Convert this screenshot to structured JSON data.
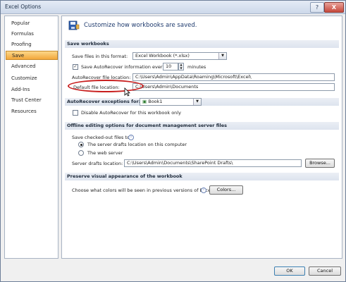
{
  "window": {
    "title": "Excel Options"
  },
  "titlebar": {
    "help_glyph": "?",
    "close_glyph": "X"
  },
  "sidebar": {
    "items": [
      {
        "label": "Popular"
      },
      {
        "label": "Formulas"
      },
      {
        "label": "Proofing"
      },
      {
        "label": "Save",
        "selected": true
      },
      {
        "label": "Advanced"
      },
      {
        "label": "Customize"
      },
      {
        "label": "Add-Ins"
      },
      {
        "label": "Trust Center"
      },
      {
        "label": "Resources"
      }
    ]
  },
  "header": {
    "text": "Customize how workbooks are saved.",
    "icon": "save-workbook-icon"
  },
  "save_workbooks": {
    "heading": "Save workbooks",
    "format_label": "Save files in this format:",
    "format_value": "Excel Workbook (*.xlsx)",
    "autorecover_label": "Save AutoRecover information every",
    "autorecover_checked": true,
    "autorecover_minutes": "10",
    "minutes_label": "minutes",
    "autorecover_location_label": "AutoRecover file location:",
    "autorecover_location_value": "C:\\Users\\Admin\\AppData\\Roaming\\Microsoft\\Excel\\",
    "default_location_label": "Default file location:",
    "default_location_value": "C:\\Users\\Admin\\Documents"
  },
  "exceptions": {
    "label": "AutoRecover exceptions for:",
    "workbook_value": "Book1",
    "disable_label": "Disable AutoRecover for this workbook only",
    "disable_checked": false
  },
  "offline": {
    "heading": "Offline editing options for document management server files",
    "save_to_label": "Save checked-out files to:",
    "option_server_drafts": "The server drafts location on this computer",
    "option_web_server": "The web server",
    "selected_option": "server_drafts",
    "drafts_location_label": "Server drafts location:",
    "drafts_location_value": "C:\\Users\\Admin\\Documents\\SharePoint Drafts\\",
    "browse_label": "Browse..."
  },
  "visual": {
    "heading": "Preserve visual appearance of the workbook",
    "colors_question": "Choose what colors will be seen in previous versions of Excel:",
    "colors_button": "Colors..."
  },
  "footer": {
    "ok_label": "OK",
    "cancel_label": "Cancel"
  },
  "colors": {
    "selected_gradient_top": "#fcd88a",
    "selected_gradient_bottom": "#f3a73b",
    "highlight_oval": "#c81e1e",
    "header_text": "#1f3b6e"
  }
}
